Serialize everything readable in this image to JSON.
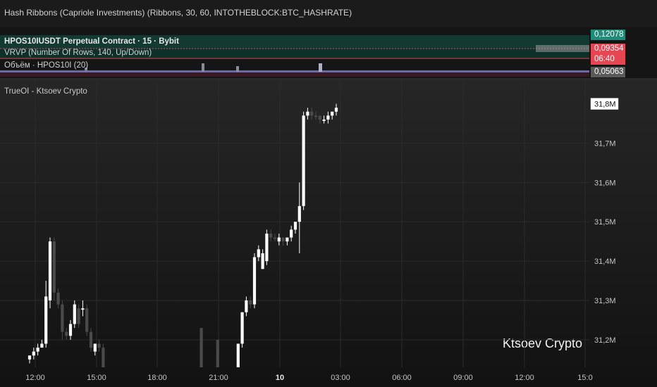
{
  "top_bar": {
    "title": "Hash Ribbons (Capriole Investments) (Ribbons, 30, 60, INTOTHEBLOCK:BTC_HASHRATE)"
  },
  "mini_pane": {
    "symbol_title": "HPOS10IUSDT Perpetual Contract · 15 · Bybit",
    "vrvp_label": "VRVP (Number Of Rows, 140, Up/Down)",
    "volume_label": "Объём · HPOS10I (20)",
    "price_tags": [
      {
        "text": "0,12078",
        "color": "#1e8c78"
      },
      {
        "text": "0,09354",
        "color": "#e64552"
      },
      {
        "text": "06:40",
        "color": "#e64552"
      },
      {
        "text": "0,05063",
        "color": "#5a5a5a"
      }
    ]
  },
  "main_pane": {
    "indicator_label": "TrueOI - Ktsoev Crypto",
    "watermark": "Ktsoev Crypto",
    "current_value_tag": "31,8M"
  },
  "chart_data": {
    "type": "candlestick",
    "title": "TrueOI - Ktsoev Crypto",
    "y_unit": "M",
    "y_axis_labels": [
      "31,7M",
      "31,6M",
      "31,5M",
      "31,4M",
      "31,3M",
      "31,2M"
    ],
    "y_axis_values": [
      31.7,
      31.6,
      31.5,
      31.4,
      31.3,
      31.2
    ],
    "ylim": [
      31.13,
      31.86
    ],
    "x_axis_labels": [
      "12:00",
      "15:00",
      "18:00",
      "21:00",
      "10",
      "03:00",
      "06:00",
      "09:00",
      "12:00",
      "15:0"
    ],
    "x_axis_bold": [
      false,
      false,
      false,
      false,
      true,
      false,
      false,
      false,
      false,
      false
    ],
    "grid": true,
    "candles": [
      {
        "slot": 0,
        "o": 31.15,
        "c": 31.16,
        "h": 31.16,
        "l": 31.14,
        "up": true
      },
      {
        "slot": 1,
        "o": 31.16,
        "c": 31.17,
        "h": 31.18,
        "l": 31.15,
        "up": true
      },
      {
        "slot": 2,
        "o": 31.17,
        "c": 31.18,
        "h": 31.19,
        "l": 31.16,
        "up": true
      },
      {
        "slot": 3,
        "o": 31.18,
        "c": 31.19,
        "h": 31.2,
        "l": 31.18,
        "up": true
      },
      {
        "slot": 4,
        "o": 31.19,
        "c": 31.31,
        "h": 31.35,
        "l": 31.18,
        "up": true
      },
      {
        "slot": 5,
        "o": 31.3,
        "c": 31.45,
        "h": 31.46,
        "l": 31.28,
        "up": true
      },
      {
        "slot": 6,
        "o": 31.45,
        "c": 31.32,
        "h": 31.46,
        "l": 31.3,
        "up": false
      },
      {
        "slot": 7,
        "o": 31.32,
        "c": 31.29,
        "h": 31.33,
        "l": 31.28,
        "up": false
      },
      {
        "slot": 8,
        "o": 31.29,
        "c": 31.22,
        "h": 31.3,
        "l": 31.2,
        "up": false
      },
      {
        "slot": 9,
        "o": 31.22,
        "c": 31.21,
        "h": 31.23,
        "l": 31.2,
        "up": false
      },
      {
        "slot": 10,
        "o": 31.21,
        "c": 31.24,
        "h": 31.25,
        "l": 31.2,
        "up": true
      },
      {
        "slot": 11,
        "o": 31.24,
        "c": 31.29,
        "h": 31.3,
        "l": 31.23,
        "up": true
      },
      {
        "slot": 12,
        "o": 31.28,
        "c": 31.24,
        "h": 31.29,
        "l": 31.23,
        "up": false
      },
      {
        "slot": 13,
        "o": 31.28,
        "c": 31.28,
        "h": 31.3,
        "l": 31.26,
        "up": true
      },
      {
        "slot": 14,
        "o": 31.28,
        "c": 31.22,
        "h": 31.29,
        "l": 31.21,
        "up": false
      },
      {
        "slot": 15,
        "o": 31.22,
        "c": 31.18,
        "h": 31.23,
        "l": 31.17,
        "up": false
      },
      {
        "slot": 16,
        "o": 31.17,
        "c": 31.19,
        "h": 31.19,
        "l": 31.16,
        "up": true
      },
      {
        "slot": 17,
        "o": 31.19,
        "c": 31.18,
        "h": 31.2,
        "l": 31.17,
        "up": false
      },
      {
        "slot": 18,
        "o": 31.18,
        "c": 31.13,
        "h": 31.19,
        "l": 31.12,
        "up": false
      },
      {
        "slot": 42,
        "o": 31.23,
        "c": 31.13,
        "h": 31.23,
        "l": 31.12,
        "up": false
      },
      {
        "slot": 46,
        "o": 31.2,
        "c": 31.13,
        "h": 31.2,
        "l": 31.13,
        "up": false
      },
      {
        "slot": 51,
        "o": 31.13,
        "c": 31.19,
        "h": 31.19,
        "l": 31.12,
        "up": true
      },
      {
        "slot": 52,
        "o": 31.19,
        "c": 31.27,
        "h": 31.27,
        "l": 31.18,
        "up": true
      },
      {
        "slot": 53,
        "o": 31.27,
        "c": 31.3,
        "h": 31.31,
        "l": 31.26,
        "up": true
      },
      {
        "slot": 54,
        "o": 31.3,
        "c": 31.29,
        "h": 31.31,
        "l": 31.28,
        "up": false
      },
      {
        "slot": 55,
        "o": 31.29,
        "c": 31.41,
        "h": 31.42,
        "l": 31.28,
        "up": true
      },
      {
        "slot": 56,
        "o": 31.41,
        "c": 31.43,
        "h": 31.44,
        "l": 31.4,
        "up": true
      },
      {
        "slot": 57,
        "o": 31.38,
        "c": 31.42,
        "h": 31.43,
        "l": 31.38,
        "up": true
      },
      {
        "slot": 58,
        "o": 31.4,
        "c": 31.47,
        "h": 31.48,
        "l": 31.39,
        "up": true
      },
      {
        "slot": 59,
        "o": 31.47,
        "c": 31.46,
        "h": 31.48,
        "l": 31.45,
        "up": false
      },
      {
        "slot": 60,
        "o": 31.46,
        "c": 31.46,
        "h": 31.47,
        "l": 31.45,
        "up": false
      },
      {
        "slot": 61,
        "o": 31.45,
        "c": 31.46,
        "h": 31.47,
        "l": 31.44,
        "up": true
      },
      {
        "slot": 62,
        "o": 31.46,
        "c": 31.45,
        "h": 31.46,
        "l": 31.44,
        "up": false
      },
      {
        "slot": 63,
        "o": 31.45,
        "c": 31.46,
        "h": 31.46,
        "l": 31.44,
        "up": true
      },
      {
        "slot": 64,
        "o": 31.46,
        "c": 31.48,
        "h": 31.49,
        "l": 31.45,
        "up": true
      },
      {
        "slot": 65,
        "o": 31.48,
        "c": 31.5,
        "h": 31.5,
        "l": 31.47,
        "up": true
      },
      {
        "slot": 66,
        "o": 31.5,
        "c": 31.54,
        "h": 31.6,
        "l": 31.42,
        "up": true
      },
      {
        "slot": 67,
        "o": 31.54,
        "c": 31.77,
        "h": 31.78,
        "l": 31.53,
        "up": true
      },
      {
        "slot": 68,
        "o": 31.77,
        "c": 31.78,
        "h": 31.79,
        "l": 31.76,
        "up": true
      },
      {
        "slot": 69,
        "o": 31.78,
        "c": 31.77,
        "h": 31.79,
        "l": 31.76,
        "up": false
      },
      {
        "slot": 70,
        "o": 31.77,
        "c": 31.77,
        "h": 31.78,
        "l": 31.76,
        "up": false
      },
      {
        "slot": 71,
        "o": 31.77,
        "c": 31.76,
        "h": 31.77,
        "l": 31.75,
        "up": false
      },
      {
        "slot": 72,
        "o": 31.76,
        "c": 31.76,
        "h": 31.77,
        "l": 31.75,
        "up": true
      },
      {
        "slot": 73,
        "o": 31.76,
        "c": 31.77,
        "h": 31.78,
        "l": 31.75,
        "up": true
      },
      {
        "slot": 74,
        "o": 31.77,
        "c": 31.78,
        "h": 31.78,
        "l": 31.76,
        "up": true
      },
      {
        "slot": 75,
        "o": 31.78,
        "c": 31.79,
        "h": 31.8,
        "l": 31.77,
        "up": true
      }
    ],
    "current_value": 31.8
  },
  "colors": {
    "up": "#ffffff",
    "down": "#4a4a4a",
    "grid": "#2b2b2b",
    "axis_text": "#c4c4c4",
    "teal_tag": "#1e8c78",
    "red_tag": "#e64552"
  }
}
